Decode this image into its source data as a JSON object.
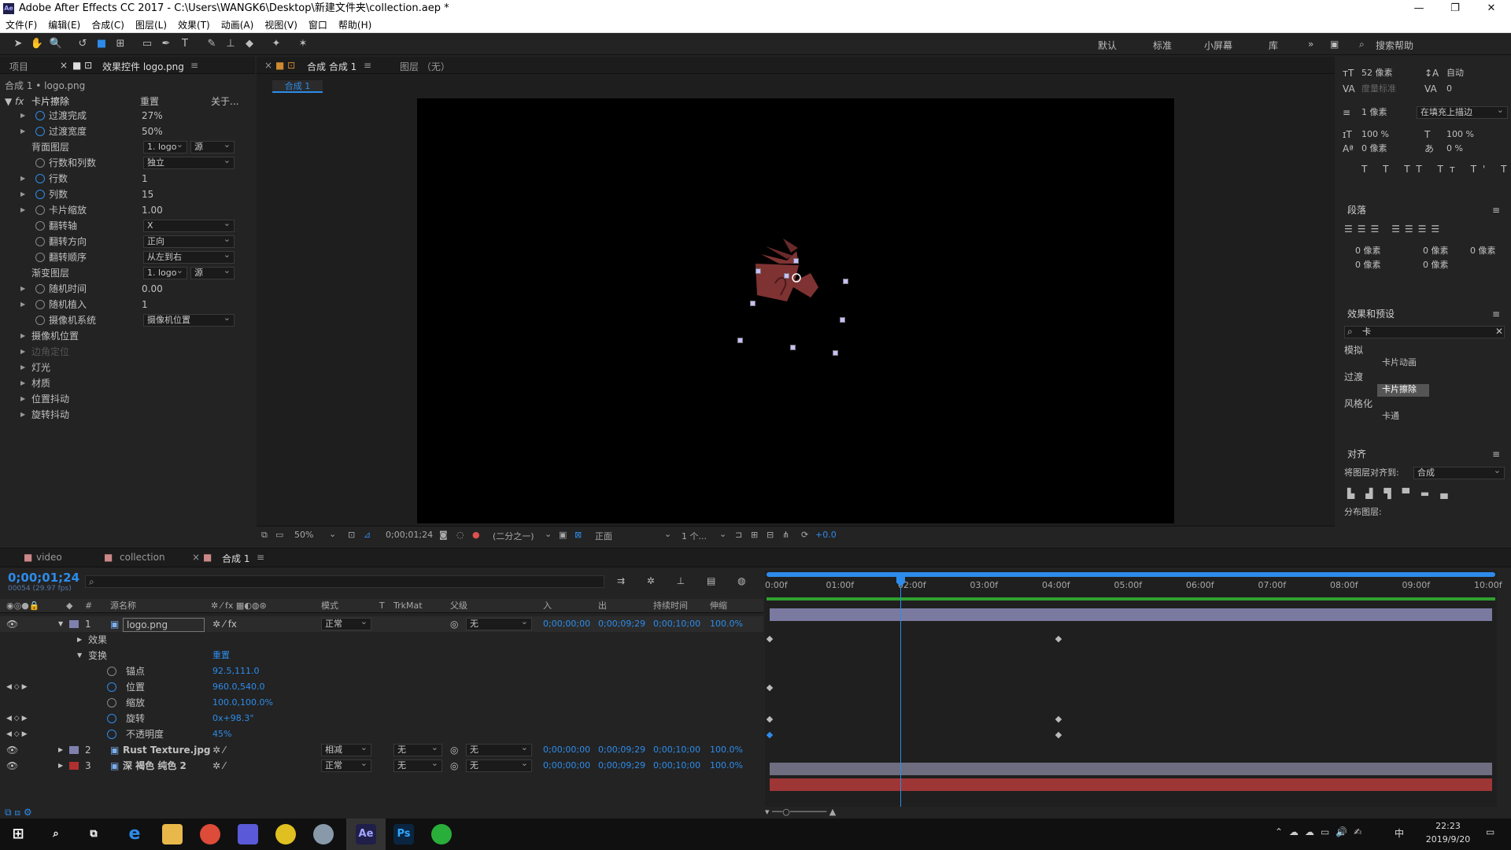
{
  "app": {
    "title": "Adobe After Effects CC 2017 - C:\\Users\\WANGK6\\Desktop\\新建文件夹\\collection.aep *",
    "logo": "Ae"
  },
  "menu": [
    "文件(F)",
    "编辑(E)",
    "合成(C)",
    "图层(L)",
    "效果(T)",
    "动画(A)",
    "视图(V)",
    "窗口",
    "帮助(H)"
  ],
  "workspaces": [
    "默认",
    "标准",
    "小屏幕",
    "库"
  ],
  "search_help": "搜索帮助",
  "left_panel": {
    "tab_project": "项目",
    "tab_effects": "效果控件 logo.png",
    "breadcrumb": "合成 1 • logo.png",
    "effect_name": "卡片擦除",
    "reset": "重置",
    "about": "关于...",
    "props": [
      {
        "label": "过渡完成",
        "value": "27%"
      },
      {
        "label": "过渡宽度",
        "value": "50%"
      },
      {
        "label": "背面图层",
        "value": "1. logo",
        "value2": "源"
      },
      {
        "label": "行数和列数",
        "value": "独立"
      },
      {
        "label": "行数",
        "value": "1"
      },
      {
        "label": "列数",
        "value": "15"
      },
      {
        "label": "卡片缩放",
        "value": "1.00"
      },
      {
        "label": "翻转轴",
        "value": "X"
      },
      {
        "label": "翻转方向",
        "value": "正向"
      },
      {
        "label": "翻转顺序",
        "value": "从左到右"
      },
      {
        "label": "渐变图层",
        "value": "1. logo",
        "value2": "源"
      },
      {
        "label": "随机时间",
        "value": "0.00"
      },
      {
        "label": "随机植入",
        "value": "1"
      },
      {
        "label": "摄像机系统",
        "value": "摄像机位置"
      }
    ],
    "groups": [
      "摄像机位置",
      "边角定位",
      "灯光",
      "材质",
      "位置抖动",
      "旋转抖动"
    ]
  },
  "comp_panel": {
    "tab_comp": "合成 合成 1",
    "tab_layer": "图层 （无）",
    "sub_tab": "合成 1",
    "zoom": "50%",
    "timecode": "0;00;01;24",
    "resolution": "(二分之一)",
    "view": "正面",
    "views_count": "1 个...",
    "exposure": "+0.0"
  },
  "right_panel": {
    "font_size": "52 像素",
    "leading": "自动",
    "tracking_label": "度量标准",
    "tracking": "0",
    "stroke": "1 像素",
    "stroke_mode": "在填充上描边",
    "vscale": "100 %",
    "hscale": "100 %",
    "baseline": "0 像素",
    "tsume": "0 %",
    "paragraph_title": "段落",
    "indent_vals": [
      "0 像素",
      "0 像素",
      "0 像素",
      "0 像素",
      "0 像素"
    ],
    "effects_title": "效果和预设",
    "effects_search": "卡",
    "effects_tree": [
      {
        "group": "模拟",
        "items": [
          "卡片动画"
        ]
      },
      {
        "group": "过渡",
        "items": [
          "卡片擦除"
        ]
      },
      {
        "group": "风格化",
        "items": [
          "卡通"
        ]
      }
    ],
    "align_title": "对齐",
    "align_to_label": "将图层对齐到:",
    "align_to": "合成",
    "distribute_label": "分布图层:"
  },
  "timeline": {
    "tabs": [
      "video",
      "collection",
      "合成 1"
    ],
    "timecode": "0;00;01;24",
    "fps": "00054 (29.97 fps)",
    "headers": {
      "name": "源名称",
      "mode": "模式",
      "t": "T",
      "trkmat": "TrkMat",
      "parent": "父级",
      "in": "入",
      "out": "出",
      "duration": "持续时间",
      "stretch": "伸缩"
    },
    "ruler": [
      "0:00f",
      "01:00f",
      "02:00f",
      "03:00f",
      "04:00f",
      "05:00f",
      "06:00f",
      "07:00f",
      "08:00f",
      "09:00f",
      "10:00f"
    ],
    "layers": [
      {
        "num": "1",
        "name": "logo.png",
        "mode": "正常",
        "trkmat": "",
        "parent": "无",
        "in": "0;00;00;00",
        "out": "0;00;09;29",
        "dur": "0;00;10;00",
        "stretch": "100.0%",
        "color": "#8080b0"
      },
      {
        "num": "2",
        "name": "Rust Texture.jpg",
        "mode": "相减",
        "trkmat": "无",
        "parent": "无",
        "in": "0;00;00;00",
        "out": "0;00;09;29",
        "dur": "0;00;10;00",
        "stretch": "100.0%",
        "color": "#8080b0"
      },
      {
        "num": "3",
        "name": "深 褐色 纯色 2",
        "mode": "正常",
        "trkmat": "无",
        "parent": "无",
        "in": "0;00;00;00",
        "out": "0;00;09;29",
        "dur": "0;00;10;00",
        "stretch": "100.0%",
        "color": "#b03030"
      }
    ],
    "sub": {
      "effects": "效果",
      "transform": "变换",
      "transform_reset": "重置",
      "anchor": "锚点",
      "anchor_val": "92.5,111.0",
      "position": "位置",
      "position_val": "960.0,540.0",
      "scale": "缩放",
      "scale_val": "100.0,100.0%",
      "rotation": "旋转",
      "rotation_val": "0x+98.3°",
      "opacity": "不透明度",
      "opacity_val": "45%"
    }
  },
  "taskbar": {
    "time": "22:23",
    "date": "2019/9/20",
    "ime": "中"
  }
}
